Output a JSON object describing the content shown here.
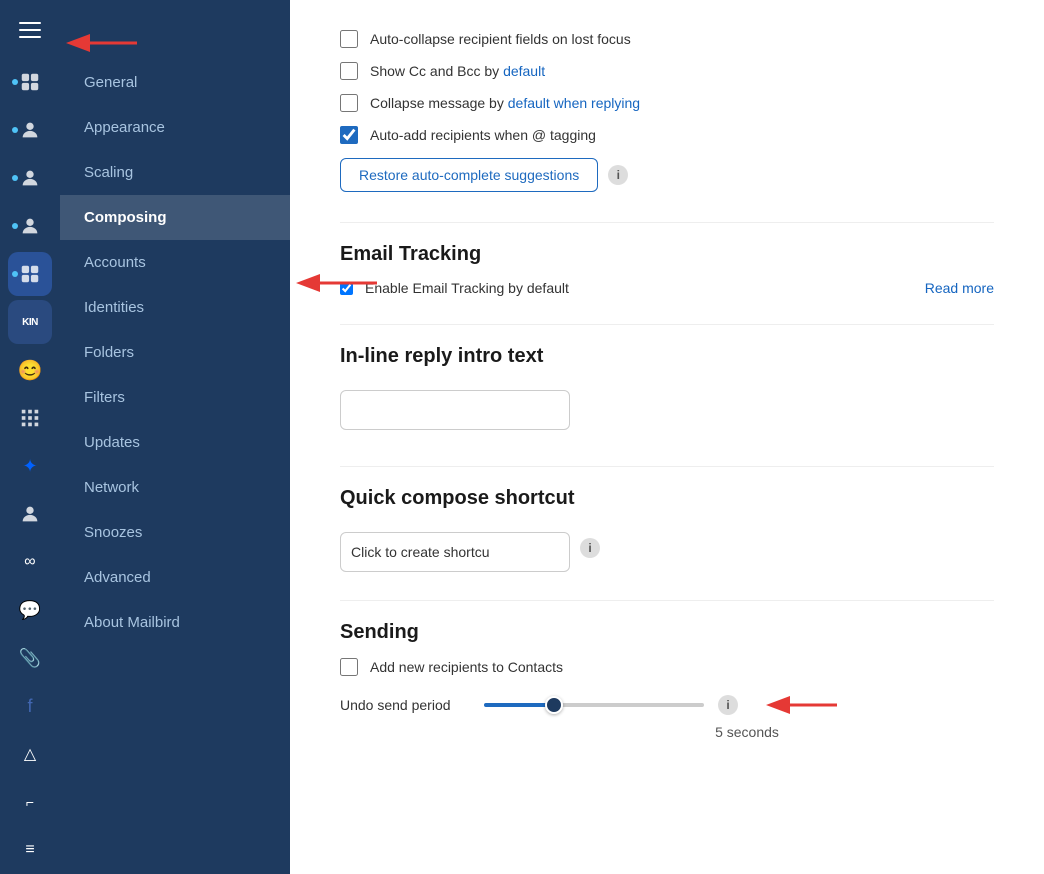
{
  "sidebar": {
    "items": [
      {
        "label": "General",
        "active": false,
        "id": "general"
      },
      {
        "label": "Appearance",
        "active": false,
        "id": "appearance"
      },
      {
        "label": "Scaling",
        "active": false,
        "id": "scaling"
      },
      {
        "label": "Composing",
        "active": true,
        "id": "composing"
      },
      {
        "label": "Accounts",
        "active": false,
        "id": "accounts"
      },
      {
        "label": "Identities",
        "active": false,
        "id": "identities"
      },
      {
        "label": "Folders",
        "active": false,
        "id": "folders"
      },
      {
        "label": "Filters",
        "active": false,
        "id": "filters"
      },
      {
        "label": "Updates",
        "active": false,
        "id": "updates"
      },
      {
        "label": "Network",
        "active": false,
        "id": "network"
      },
      {
        "label": "Snoozes",
        "active": false,
        "id": "snoozes"
      },
      {
        "label": "Advanced",
        "active": false,
        "id": "advanced"
      },
      {
        "label": "About Mailbird",
        "active": false,
        "id": "about"
      }
    ]
  },
  "content": {
    "checkboxes": [
      {
        "label": "Auto-collapse recipient fields on lost focus",
        "checked": false,
        "highlight": null
      },
      {
        "label": "Show Cc and Bcc by default",
        "checked": false,
        "highlight": "default"
      },
      {
        "label": "Collapse message by default when replying",
        "checked": false,
        "highlight": "default when replying"
      },
      {
        "label": "Auto-add recipients when @ tagging",
        "checked": true,
        "highlight": null
      }
    ],
    "restore_button_label": "Restore auto-complete suggestions",
    "email_tracking_title": "Email Tracking",
    "email_tracking_label": "Enable Email Tracking by default",
    "email_tracking_checked": true,
    "read_more_label": "Read more",
    "inline_reply_title": "In-line reply intro text",
    "inline_reply_placeholder": "",
    "quick_compose_title": "Quick compose shortcut",
    "quick_compose_placeholder": "Click to create shortcu",
    "sending_title": "Sending",
    "add_recipients_label": "Add new recipients to Contacts",
    "add_recipients_checked": false,
    "undo_send_label": "Undo send period",
    "undo_send_value": "5 seconds",
    "slider_value": 30
  }
}
